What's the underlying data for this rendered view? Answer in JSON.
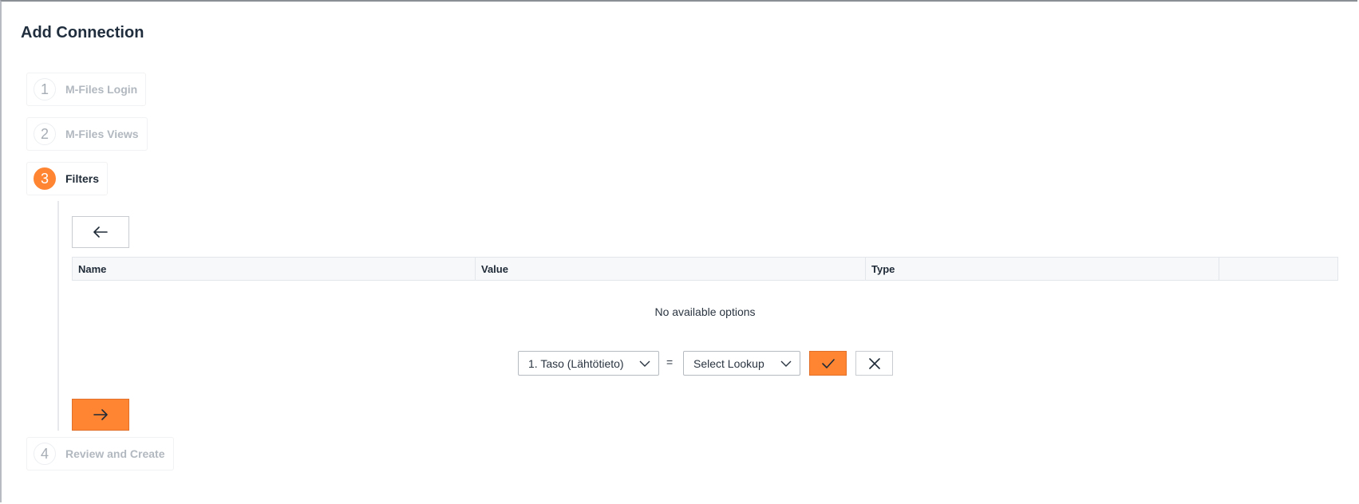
{
  "dialog": {
    "title": "Add Connection"
  },
  "steps": [
    {
      "number": "1",
      "label": "M-Files Login",
      "state": "done"
    },
    {
      "number": "2",
      "label": "M-Files Views",
      "state": "done"
    },
    {
      "number": "3",
      "label": "Filters",
      "state": "active"
    },
    {
      "number": "4",
      "label": "Review and Create",
      "state": "pending"
    }
  ],
  "filters": {
    "columns": [
      "Name",
      "Value",
      "Type",
      ""
    ],
    "empty_message": "No available options",
    "property_select_value": "1. Taso (Lähtötieto)",
    "operator": "=",
    "lookup_select_placeholder": "Select Lookup"
  },
  "icons": {
    "back": "arrow-left-icon",
    "next": "arrow-right-icon",
    "confirm": "check-icon",
    "cancel": "close-icon",
    "dropdown": "chevron-down-icon"
  },
  "colors": {
    "accent": "#ff8533",
    "text": "#1f2a37",
    "muted": "#b2b8bf"
  }
}
